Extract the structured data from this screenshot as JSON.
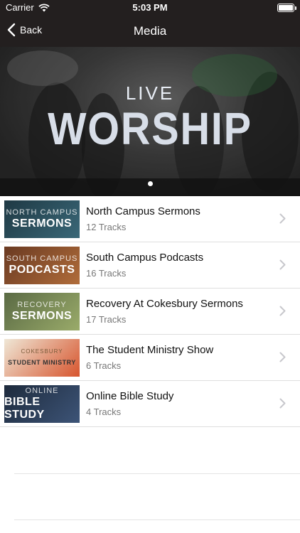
{
  "status_bar": {
    "carrier": "Carrier",
    "time": "5:03 PM",
    "battery_level": 1.0
  },
  "nav": {
    "back_label": "Back",
    "title": "Media"
  },
  "hero": {
    "small_text": "LIVE",
    "big_text": "WORSHIP",
    "page_count": 1,
    "active_page": 0
  },
  "items": [
    {
      "name": "North Campus Sermons",
      "tracks": "12 Tracks",
      "thumb_line1": "NORTH CAMPUS",
      "thumb_line2": "SERMONS",
      "thumb_bg": "#1f3944",
      "thumb_accent": "#3a6878"
    },
    {
      "name": "South Campus Podcasts",
      "tracks": "16 Tracks",
      "thumb_line1": "SOUTH CAMPUS",
      "thumb_line2": "PODCASTS",
      "thumb_bg": "#6a3a22",
      "thumb_accent": "#b06c3a"
    },
    {
      "name": "Recovery At Cokesbury Sermons",
      "tracks": "17 Tracks",
      "thumb_line1": "RECOVERY",
      "thumb_line2": "SERMONS",
      "thumb_bg": "#5a6a44",
      "thumb_accent": "#9aab6a"
    },
    {
      "name": "The Student Ministry Show",
      "tracks": "6 Tracks",
      "thumb_line1": "COKESBURY",
      "thumb_line2": "STUDENT MINISTRY",
      "thumb_bg": "#efe7d6",
      "thumb_accent": "#d7552e"
    },
    {
      "name": "Online Bible Study",
      "tracks": "4 Tracks",
      "thumb_line1": "ONLINE",
      "thumb_line2": "BIBLE STUDY",
      "thumb_bg": "#1d2a3c",
      "thumb_accent": "#3d5477"
    }
  ],
  "icons": {
    "back": "chevron-left-icon",
    "row": "chevron-right-icon",
    "wifi": "wifi-icon",
    "battery": "battery-icon"
  },
  "colors": {
    "bar_bg": "#231f1f",
    "chevron": "#c7c7cc",
    "separator": "#dedede"
  }
}
